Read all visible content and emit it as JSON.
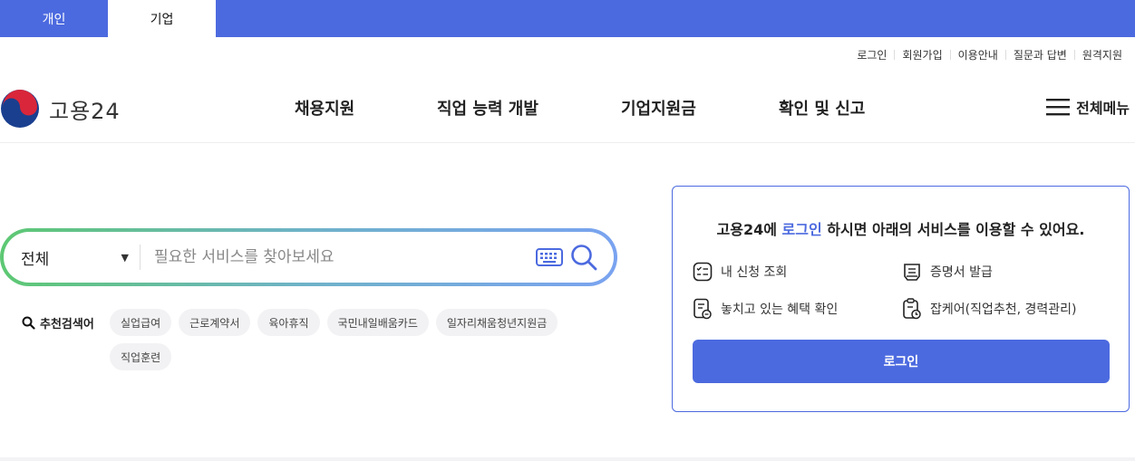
{
  "tabs": {
    "personal": "개인",
    "corporate": "기업"
  },
  "util_links": [
    "로그인",
    "회원가입",
    "이용안내",
    "질문과 답변",
    "원격지원"
  ],
  "logo": {
    "text": "고용24"
  },
  "nav": [
    "채용지원",
    "직업 능력 개발",
    "기업지원금",
    "확인 및 신고"
  ],
  "all_menu": "전체메뉴",
  "search": {
    "scope": "전체",
    "placeholder": "필요한 서비스를 찾아보세요"
  },
  "recommended": {
    "label": "추천검색어",
    "chips": [
      "실업급여",
      "근로계약서",
      "육아휴직",
      "국민내일배움카드",
      "일자리채움청년지원금",
      "직업훈련"
    ]
  },
  "login_panel": {
    "title_pre": "고용24에 ",
    "title_hl": "로그인",
    "title_post": " 하시면 아래의 서비스를 이용할 수 있어요.",
    "services": [
      "내 신청 조회",
      "증명서 발급",
      "놓치고 있는 혜택 확인",
      "잡케어(직업추천, 경력관리)"
    ],
    "button": "로그인"
  },
  "colors": {
    "brand": "#4c6adf",
    "chip_bg": "#f2f2f4"
  }
}
